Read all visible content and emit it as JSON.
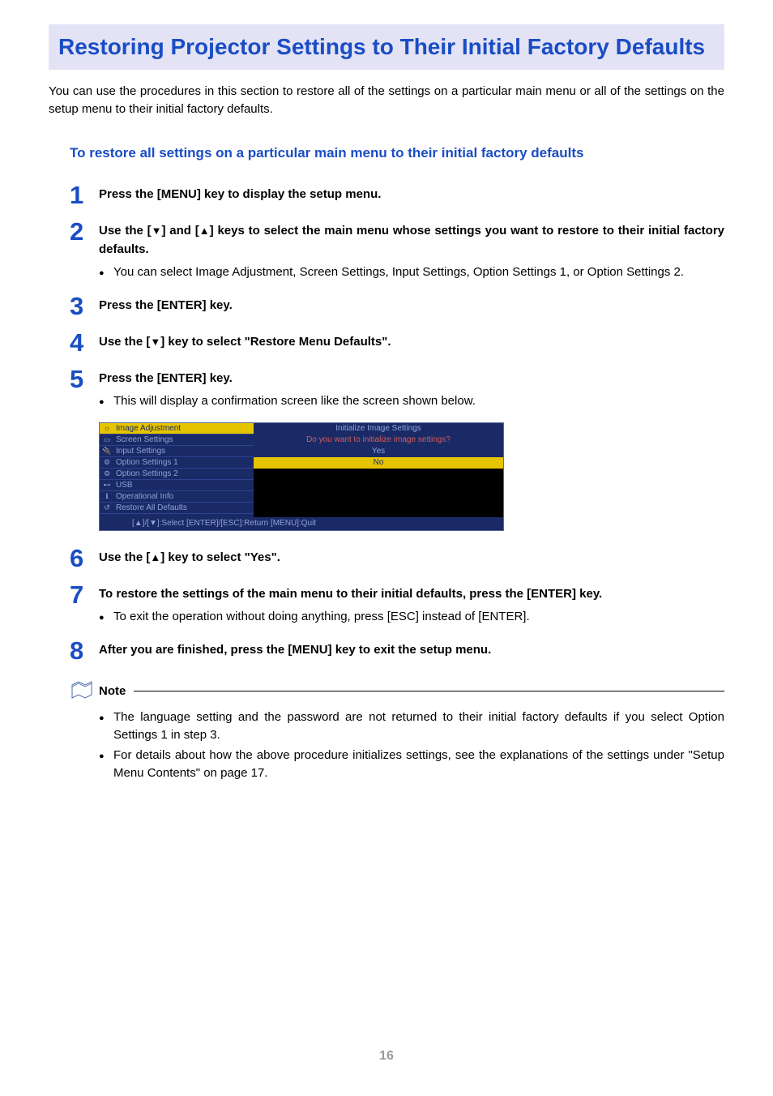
{
  "pageNumber": "16",
  "heading": "Restoring Projector Settings to Their Initial Factory Defaults",
  "intro": "You can use the procedures in this section to restore all of the settings on a particular main menu or all of the settings on the setup menu to their initial factory defaults.",
  "subheading": "To restore all settings on a particular main menu to their initial factory defaults",
  "steps": [
    {
      "num": "1",
      "title": "Press the [MENU] key to display the setup menu.",
      "subs": []
    },
    {
      "num": "2",
      "title_pre": "Use the [",
      "title_mid": "] and [",
      "title_post": "] keys to select the main menu whose settings you want to restore to their initial factory defaults.",
      "subs": [
        "You can select Image Adjustment, Screen Settings, Input Settings, Option Settings 1, or Option Settings 2."
      ]
    },
    {
      "num": "3",
      "title": "Press the [ENTER] key.",
      "subs": []
    },
    {
      "num": "4",
      "title_pre": "Use the [",
      "title_post": "] key to select \"Restore Menu Defaults\".",
      "subs": []
    },
    {
      "num": "5",
      "title": "Press the [ENTER] key.",
      "subs": [
        "This will display a confirmation screen like the screen shown below."
      ]
    },
    {
      "num": "6",
      "title_pre": "Use the [",
      "title_post": "] key to select \"Yes\".",
      "subs": []
    },
    {
      "num": "7",
      "title": "To restore the settings of the main menu to their initial defaults, press the [ENTER] key.",
      "subs": [
        "To exit the operation without doing anything, press [ESC] instead of [ENTER]."
      ]
    },
    {
      "num": "8",
      "title": "After you are finished, press the [MENU] key to exit the setup menu.",
      "subs": []
    }
  ],
  "menu": {
    "leftItems": [
      "Image Adjustment",
      "Screen Settings",
      "Input Settings",
      "Option Settings 1",
      "Option Settings 2",
      "USB",
      "Operational Info",
      "Restore All Defaults"
    ],
    "rightHeader": "Initialize Image Settings",
    "prompt": "Do you want to initialize image settings?",
    "optYes": "Yes",
    "optNo": "No",
    "footer": "[▲]/[▼]:Select [ENTER]/[ESC]:Return [MENU]:Quit"
  },
  "noteLabel": "Note",
  "notes": [
    "The language setting and the password are not returned to their initial factory defaults if you select Option Settings 1 in step 3.",
    "For details about how the above procedure initializes settings, see the explanations of the settings under \"Setup Menu Contents\" on page 17."
  ]
}
